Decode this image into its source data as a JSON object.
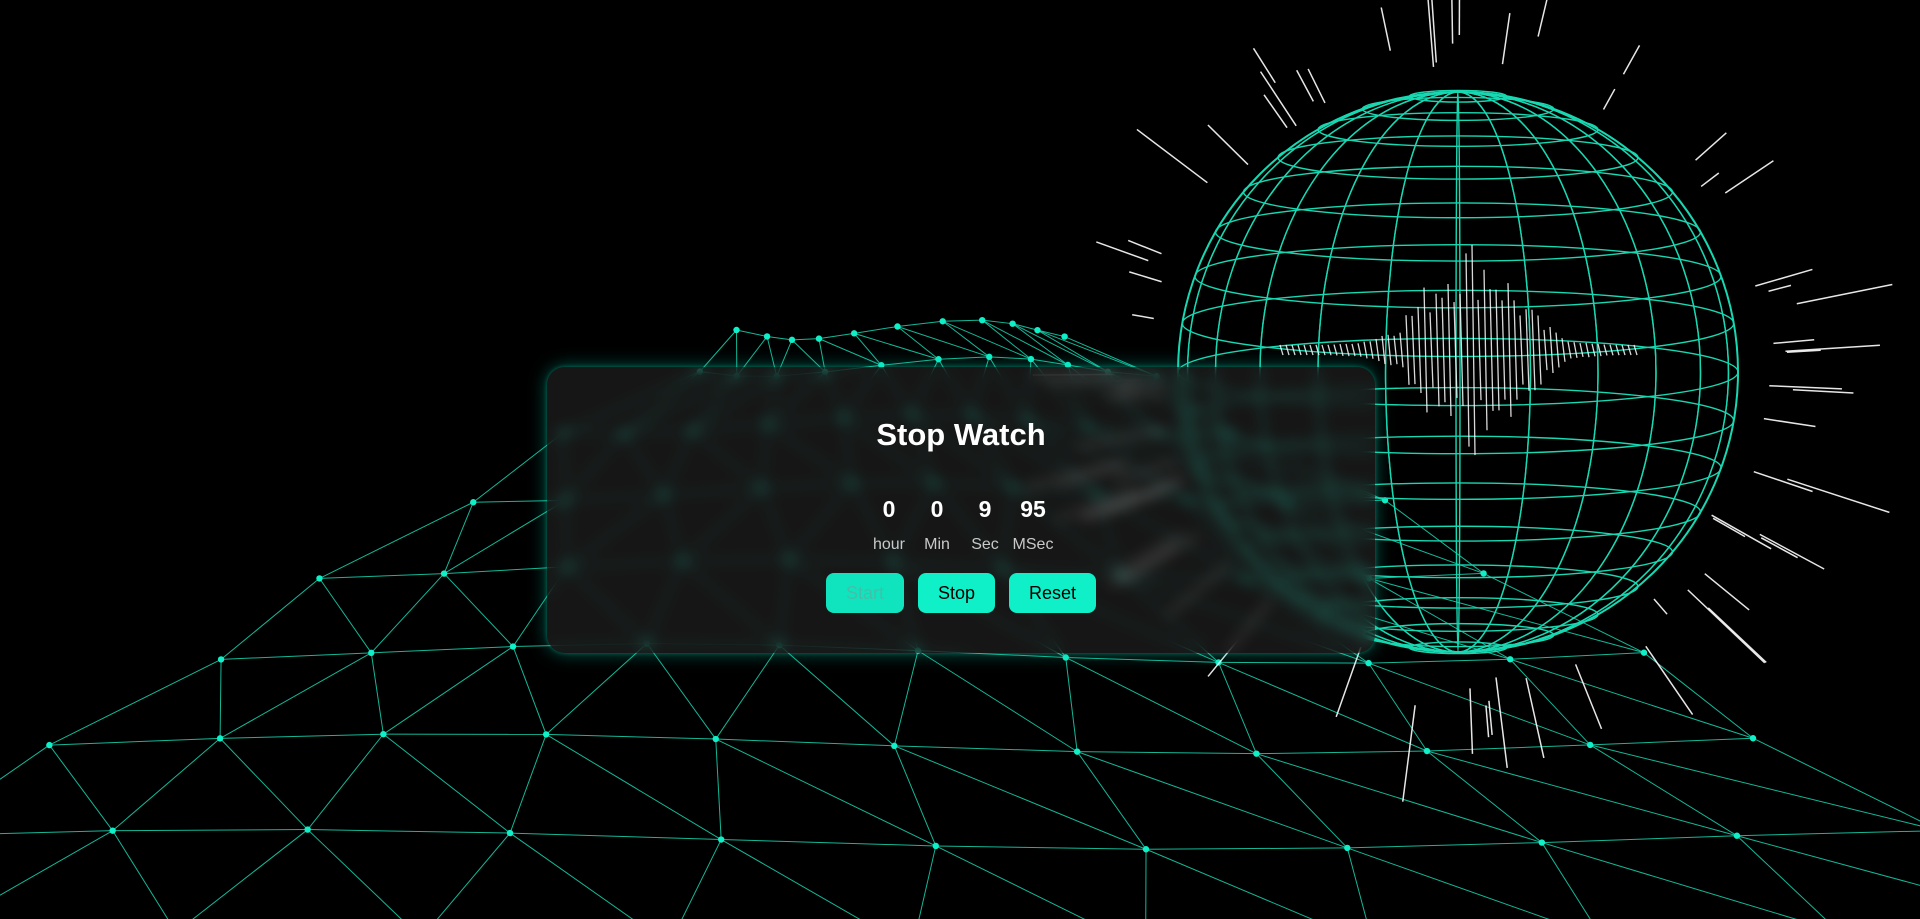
{
  "title": "Stop Watch",
  "timer": {
    "hour": {
      "value": "0",
      "label": "hour"
    },
    "min": {
      "value": "0",
      "label": "Min"
    },
    "sec": {
      "value": "9",
      "label": "Sec"
    },
    "msec": {
      "value": "95",
      "label": "MSec"
    }
  },
  "buttons": {
    "start": {
      "label": "Start",
      "disabled": true
    },
    "stop": {
      "label": "Stop"
    },
    "reset": {
      "label": "Reset"
    }
  },
  "colors": {
    "accent": "#10f0c8",
    "grid": "#18d8b2",
    "background": "#000000",
    "card": "#282828"
  }
}
